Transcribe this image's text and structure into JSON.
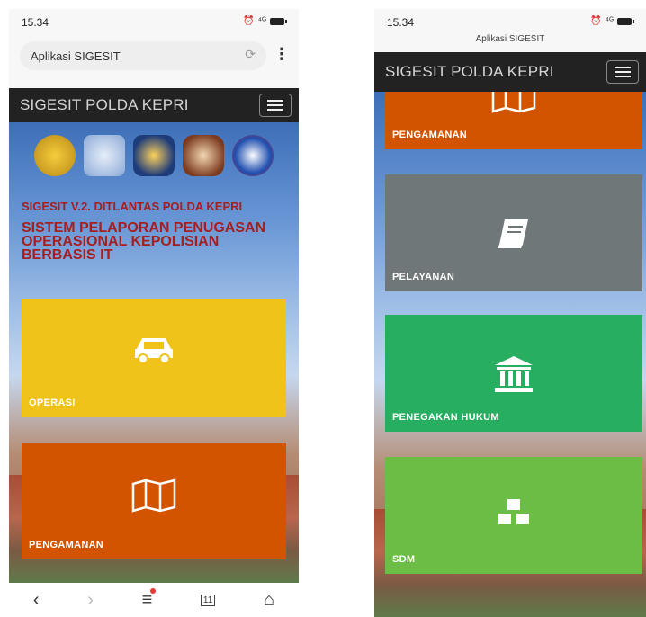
{
  "left": {
    "status": {
      "time": "15.34",
      "signal": "⁴ᴳ"
    },
    "browser": {
      "page_title": "Aplikasi SIGESIT"
    },
    "navbar": {
      "title": "SIGESIT POLDA KEPRI"
    },
    "header": {
      "subtitle": "SIGESIT V.2. DITLANTAS POLDA KEPRI",
      "title": "SISTEM PELAPORAN PENUGASAN OPERASIONAL KEPOLISIAN BERBASIS IT"
    },
    "tiles": [
      {
        "label": "OPERASI",
        "icon": "car-icon",
        "color": "#f0c31b"
      },
      {
        "label": "PENGAMANAN",
        "icon": "map-icon",
        "color": "#d35400"
      }
    ],
    "bottom_nav": {
      "back_icon": "chevron-left-icon",
      "forward_icon": "chevron-right-icon",
      "menu_icon": "menu-icon",
      "tabs_icon": "tabs-icon",
      "home_icon": "home-icon",
      "tab_count": "11"
    }
  },
  "right": {
    "status": {
      "time": "15.34",
      "signal": "⁴ᴳ"
    },
    "browser": {
      "page_title": "Aplikasi SIGESIT"
    },
    "navbar": {
      "title": "SIGESIT POLDA KEPRI"
    },
    "tiles": [
      {
        "label": "PENGAMANAN",
        "icon": "map-icon",
        "color": "#d35400"
      },
      {
        "label": "PELAYANAN",
        "icon": "book-icon",
        "color": "#6f7778"
      },
      {
        "label": "PENEGAKAN HUKUM",
        "icon": "courthouse-icon",
        "color": "#27ae60"
      },
      {
        "label": "SDM",
        "icon": "cubes-icon",
        "color": "#6cbd45"
      }
    ]
  }
}
